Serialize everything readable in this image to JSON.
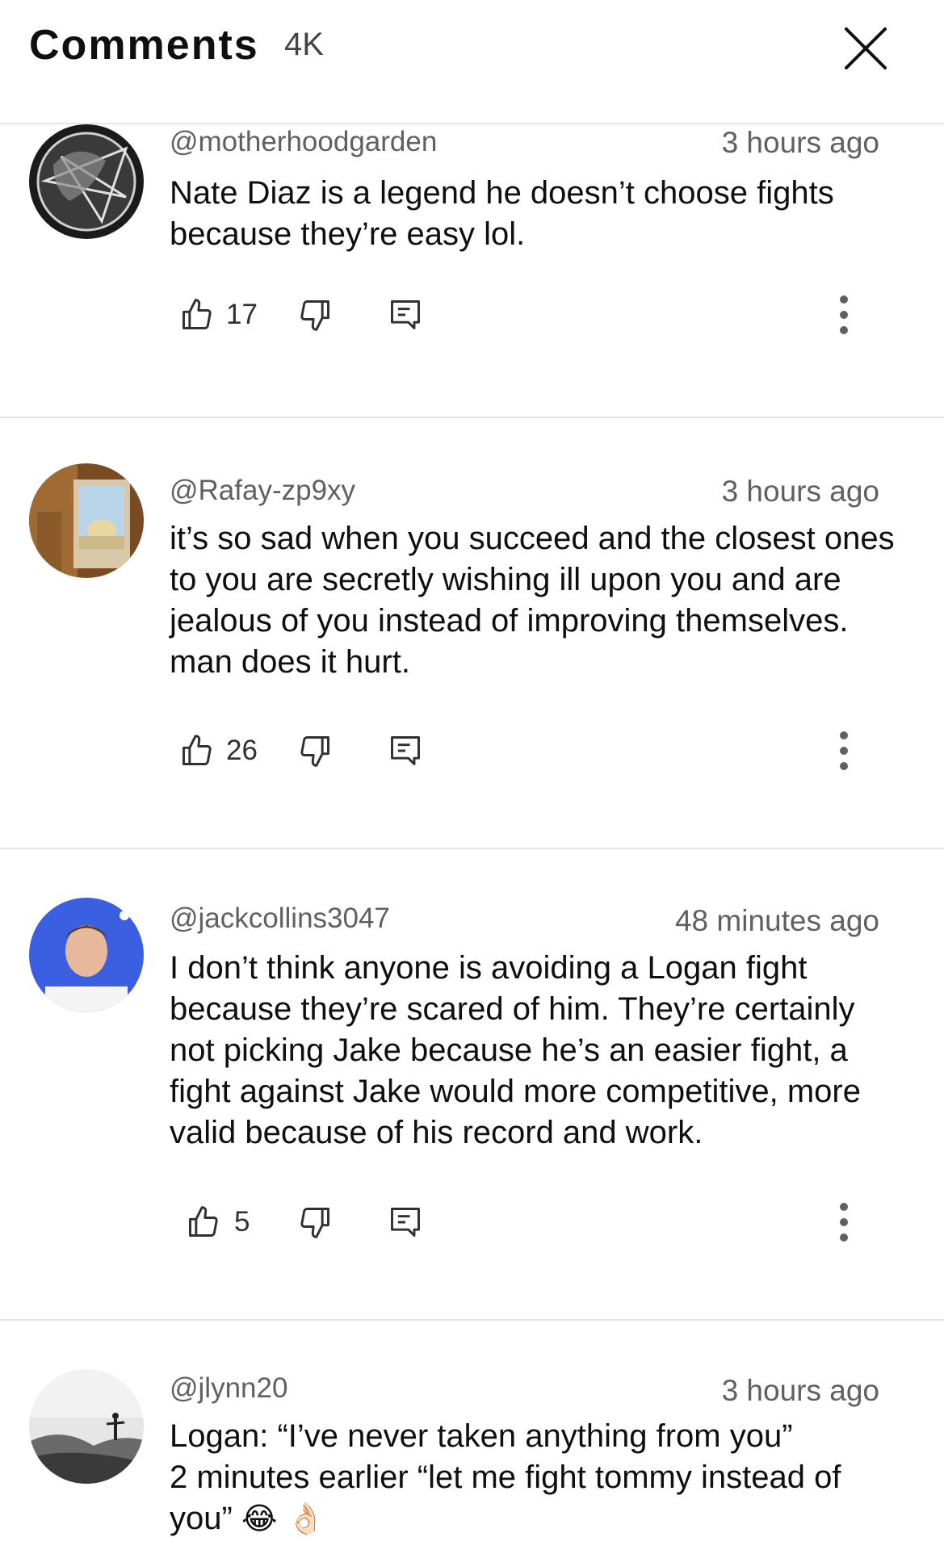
{
  "header": {
    "title": "Comments",
    "count": "4K"
  },
  "comments": [
    {
      "handle": "@motherhoodgarden",
      "time": "3 hours ago",
      "text": "Nate Diaz is a legend he doesn’t choose fights because they’re easy lol.",
      "likes": "17"
    },
    {
      "handle": "@Rafay-zp9xy",
      "time": "3 hours ago",
      "text": "it’s so sad when you succeed and the closest ones to you are secretly wishing ill upon you and are jealous of you instead of improving themselves. man does it hurt.",
      "likes": "26"
    },
    {
      "handle": "@jackcollins3047",
      "time": "48 minutes ago",
      "text": "I don’t think anyone is avoiding a Logan fight because they’re scared of him. They’re certainly not picking Jake because he’s an easier fight, a fight against Jake would more competitive, more valid because of his record and work.",
      "likes": "5"
    },
    {
      "handle": "@jlynn20",
      "time": "3 hours ago",
      "text_line1": "Logan: “I’ve never taken anything from you”",
      "text_line2": "2 minutes earlier “let me fight tommy instead of",
      "text_line3": "you”",
      "emoji": "😂 👌🏻"
    }
  ],
  "icons": {
    "close": "close-icon",
    "like": "thumbs-up-icon",
    "dislike": "thumbs-down-icon",
    "reply": "reply-icon",
    "more": "more-vertical-icon"
  }
}
